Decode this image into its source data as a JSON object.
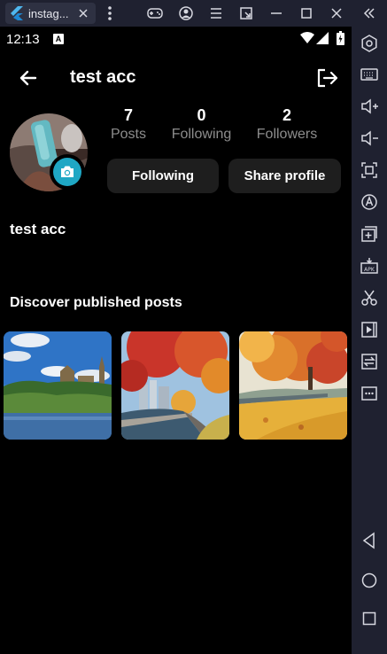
{
  "window": {
    "tab_title": "instag..."
  },
  "status_bar": {
    "time": "12:13",
    "notification_letter": "A"
  },
  "header": {
    "title": "test acc"
  },
  "profile": {
    "stats": [
      {
        "value": "7",
        "label": "Posts"
      },
      {
        "value": "0",
        "label": "Following"
      },
      {
        "value": "2",
        "label": "Followers"
      }
    ],
    "buttons": {
      "following_label": "Following",
      "share_label": "Share profile"
    },
    "display_name": "test acc"
  },
  "posts_section": {
    "title": "Discover published posts",
    "posts": [
      {
        "subject": "parliament-hill"
      },
      {
        "subject": "autumn-waterfront-city"
      },
      {
        "subject": "autumn-park-tree"
      }
    ]
  },
  "colors": {
    "screen_bg": "#000000",
    "button_bg": "#1e1e1e",
    "secondary_text": "#8d8d8d",
    "camera_badge": "#1fa7c4",
    "emulator_chrome": "#1f2130"
  },
  "icons": {
    "sidebar": [
      "settings-icon",
      "keyboard-icon",
      "volume-up-icon",
      "volume-down-icon",
      "screenshot-icon",
      "auto-click-icon",
      "add-app-icon",
      "apk-install-icon",
      "scissors-icon",
      "video-record-icon",
      "transfer-icon",
      "more-icon",
      "back-triangle-icon",
      "home-circle-icon",
      "recents-square-icon"
    ]
  }
}
